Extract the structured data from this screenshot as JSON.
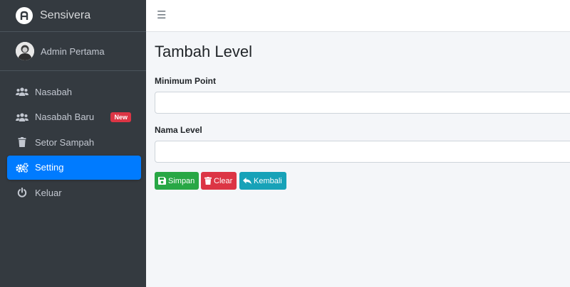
{
  "brand": {
    "name": "Sensivera",
    "logo_icon": "brand-logo-icon"
  },
  "user": {
    "name": "Admin Pertama",
    "avatar_icon": "user-avatar-icon"
  },
  "nav": {
    "items": [
      {
        "label": "Nasabah",
        "icon": "users-icon"
      },
      {
        "label": "Nasabah Baru",
        "icon": "users-icon",
        "badge": "New"
      },
      {
        "label": "Setor Sampah",
        "icon": "trash-icon"
      },
      {
        "label": "Setting",
        "icon": "gears-icon",
        "active": true
      },
      {
        "label": "Keluar",
        "icon": "power-icon"
      }
    ]
  },
  "topbar": {
    "menu_icon": "hamburger-icon"
  },
  "page": {
    "title": "Tambah Level",
    "form": {
      "minimum_point_label": "Minimum Point",
      "minimum_point_value": "",
      "nama_level_label": "Nama Level",
      "nama_level_value": ""
    },
    "buttons": {
      "save": "Simpan",
      "clear": "Clear",
      "back": "Kembali"
    }
  },
  "colors": {
    "sidebar_bg": "#343a40",
    "active": "#007bff",
    "badge": "#dc3545",
    "save": "#28a745",
    "clear": "#dc3545",
    "back": "#17a2b8"
  }
}
